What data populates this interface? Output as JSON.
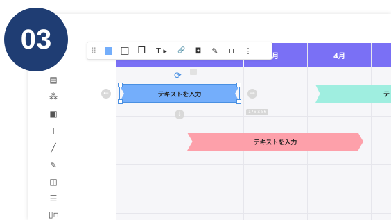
{
  "step_badge": {
    "number": "03",
    "color": "#1f3d73"
  },
  "toolbar": {
    "items": [
      {
        "icon": "drag-handle-icon",
        "glyph": "⠿"
      },
      {
        "icon": "fill-color-icon",
        "glyph": "",
        "color": "#74aefb"
      },
      {
        "icon": "border-icon",
        "glyph": "□"
      },
      {
        "icon": "shadow-icon",
        "glyph": "❐"
      },
      {
        "icon": "text-style-icon",
        "glyph": "T ▸"
      },
      {
        "icon": "link-icon",
        "glyph": "🔗"
      },
      {
        "icon": "layer-order-icon",
        "glyph": "◘"
      },
      {
        "icon": "eyedropper-icon",
        "glyph": "✎"
      },
      {
        "icon": "lock-icon",
        "glyph": "⊓"
      },
      {
        "icon": "more-icon",
        "glyph": "⋮"
      }
    ]
  },
  "timeline": {
    "header_color": "#7a70f5",
    "months": [
      "月",
      "4月",
      ""
    ]
  },
  "bars": {
    "blue": {
      "label": "テキストを入力",
      "color": "#74aefb"
    },
    "green": {
      "label": "テ",
      "color": "#9feee0"
    },
    "pink": {
      "label": "テキストを入力",
      "color": "#fda0aa"
    }
  },
  "size_label": "176 x 56",
  "sidebar": {
    "items": [
      {
        "icon": "star-icon",
        "glyph": "☆"
      },
      {
        "icon": "document-icon",
        "glyph": "▤"
      },
      {
        "icon": "shapes-icon",
        "glyph": "⁂"
      },
      {
        "icon": "image-icon",
        "glyph": "▣"
      },
      {
        "icon": "text-icon",
        "glyph": "T"
      },
      {
        "icon": "line-icon",
        "glyph": "╱"
      },
      {
        "icon": "pen-icon",
        "glyph": "✎"
      },
      {
        "icon": "sticky-note-icon",
        "glyph": "◫"
      },
      {
        "icon": "table-icon",
        "glyph": "☰"
      },
      {
        "icon": "template-icon",
        "glyph": "▯▫"
      }
    ]
  }
}
